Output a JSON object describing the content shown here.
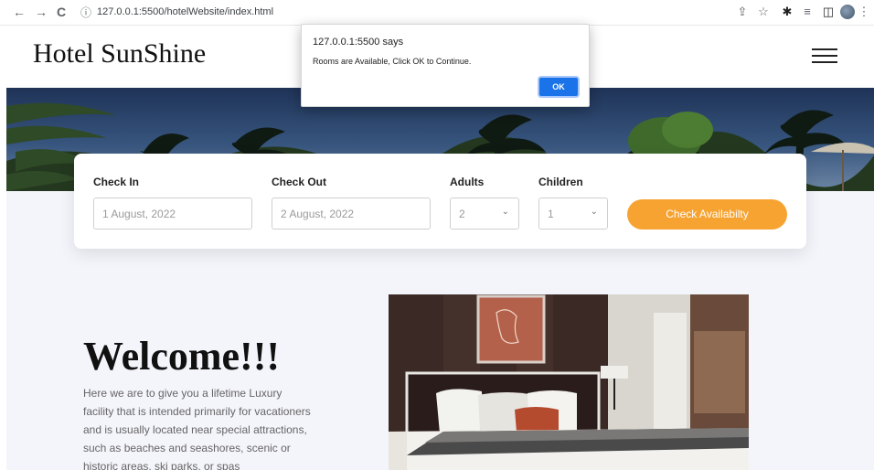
{
  "browser": {
    "url": "127.0.0.1:5500/hotelWebsite/index.html",
    "back_icon": "←",
    "forward_icon": "→",
    "reload_icon": "C",
    "info_icon": "ⓘ",
    "share_icon": "⇪",
    "star_icon": "☆",
    "extensions_icon": "✱",
    "media_icon": "≡",
    "sidepanel_icon": "◫",
    "menu_icon": "⋮"
  },
  "header": {
    "logo": "Hotel SunShine",
    "menu_icon": "hamburger"
  },
  "booking": {
    "check_in_label": "Check In",
    "check_in_value": "1 August, 2022",
    "check_out_label": "Check Out",
    "check_out_value": "2 August, 2022",
    "adults_label": "Adults",
    "adults_value": "2",
    "children_label": "Children",
    "children_value": "1",
    "button_label": "Check Availabilty",
    "button_color": "#f7a331"
  },
  "welcome": {
    "title": "Welcome!!!",
    "text": "Here we are to give you a lifetime Luxury facility that is intended primarily for vacationers and is usually located near special attractions, such as beaches and seashores, scenic or historic areas, ski parks, or spas"
  },
  "alert": {
    "title": "127.0.0.1:5500 says",
    "message": "Rooms are Available, Click OK to Continue.",
    "ok_label": "OK",
    "ok_color": "#1a73e8"
  }
}
